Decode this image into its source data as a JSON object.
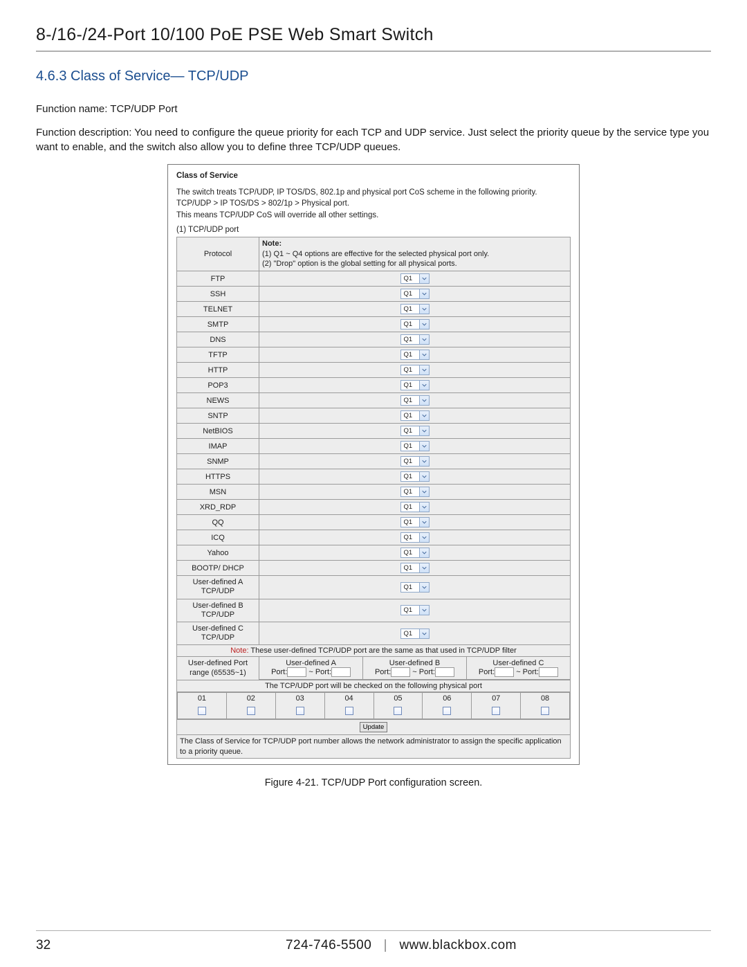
{
  "doc": {
    "title": "8-/16-/24-Port 10/100 PoE PSE Web Smart Switch",
    "section_title": "4.6.3 Class of Service— TCP/UDP",
    "function_name": "Function name:  TCP/UDP Port",
    "function_desc": "Function description: You need to configure the queue priority for each TCP and UDP service. Just select the priority queue by the service type you want to enable, and the switch also allow you to define three TCP/UDP queues.",
    "caption": "Figure 4-21. TCP/UDP Port configuration screen.",
    "page_number": "32",
    "footer_phone": "724-746-5500",
    "footer_site": "www.blackbox.com"
  },
  "panel": {
    "heading": "Class of Service",
    "intro1": "The switch treats TCP/UDP, IP TOS/DS, 802.1p and physical port CoS scheme in the following priority.",
    "intro2": "TCP/UDP > IP TOS/DS > 802/1p > Physical port.",
    "intro3": "This means TCP/UDP CoS will override all other settings.",
    "sub1": "(1) TCP/UDP port",
    "col_protocol": "Protocol",
    "note_label": "Note:",
    "note_line1": "(1) Q1 ~ Q4 options are effective for the selected physical port only.",
    "note_line2": "(2) \"Drop\" option is the global setting for all physical ports.",
    "protocols": [
      "FTP",
      "SSH",
      "TELNET",
      "SMTP",
      "DNS",
      "TFTP",
      "HTTP",
      "POP3",
      "NEWS",
      "SNTP",
      "NetBIOS",
      "IMAP",
      "SNMP",
      "HTTPS",
      "MSN",
      "XRD_RDP",
      "QQ",
      "ICQ",
      "Yahoo",
      "BOOTP/ DHCP",
      "User-defined A TCP/UDP",
      "User-defined B TCP/UDP",
      "User-defined C TCP/UDP"
    ],
    "select_value": "Q1",
    "ud_note_pre": "Note: ",
    "ud_note": "These user-defined TCP/UDP port are the same as that used in TCP/UDP filter",
    "ud_range_label": "User-defined Port range (65535~1)",
    "ud_a": "User-defined A",
    "ud_b": "User-defined B",
    "ud_c": "User-defined C",
    "port_lbl": "Port:",
    "port_to": "~ Port:",
    "phys_header": "The TCP/UDP port will be checked on the following physical port",
    "ports": [
      "01",
      "02",
      "03",
      "04",
      "05",
      "06",
      "07",
      "08"
    ],
    "update": "Update",
    "final": "The Class of Service for TCP/UDP port number allows the network administrator to assign the specific application to a priority queue."
  }
}
